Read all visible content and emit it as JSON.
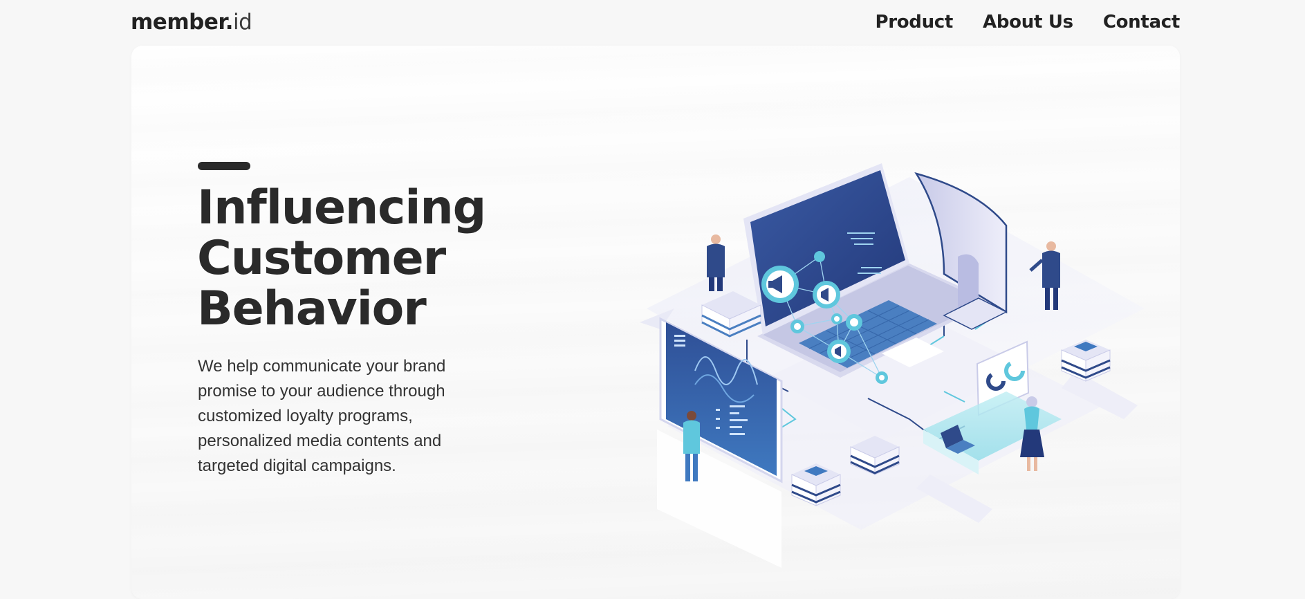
{
  "header": {
    "logo_main": "member.",
    "logo_suffix": "id",
    "nav": [
      {
        "label": "Product"
      },
      {
        "label": "About Us"
      },
      {
        "label": "Contact"
      }
    ]
  },
  "hero": {
    "headline_lines": [
      "Influencing",
      "Customer",
      "Behavior"
    ],
    "description": "We help communicate your brand promise to your audience through customized loyalty programs, personalized media contents and targeted digital campaigns."
  },
  "illustration": {
    "name": "isometric-digital-marketing-illustration",
    "icons": [
      "megaphone-icon",
      "laptop-icon",
      "monitor-icon",
      "chart-panel-icon",
      "person-icon"
    ]
  },
  "colors": {
    "text": "#2a2a2a",
    "page_bg": "#f7f7f7",
    "card_bg": "#ffffff",
    "accent_navy": "#2f4a8a",
    "accent_blue": "#4a7fc1",
    "accent_cyan": "#5fc7dd",
    "accent_lavender": "#c9cbe8"
  }
}
